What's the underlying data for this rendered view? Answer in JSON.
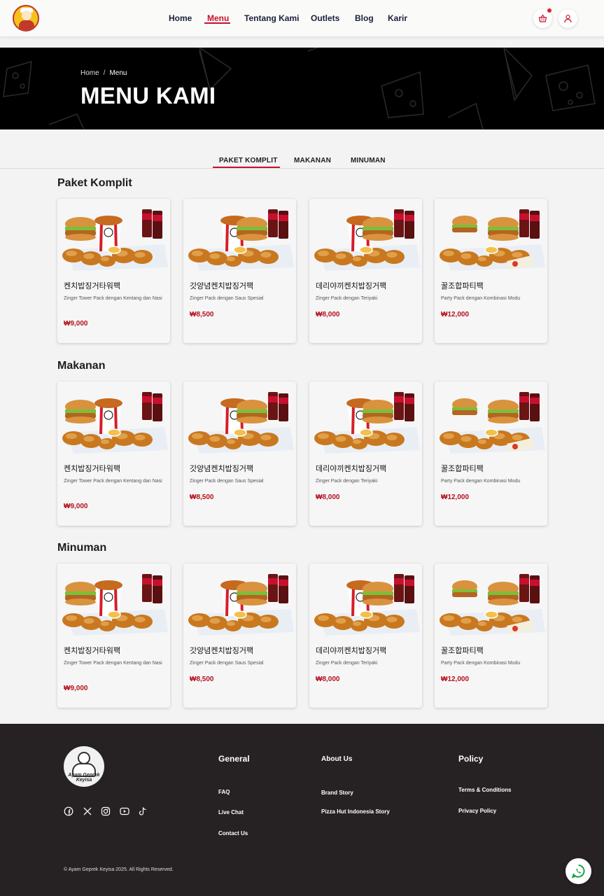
{
  "nav": {
    "items": [
      {
        "label": "Home",
        "active": false
      },
      {
        "label": "Menu",
        "active": true
      },
      {
        "label": "Tentang Kami",
        "active": false
      },
      {
        "label": "Outlets",
        "active": false
      },
      {
        "label": "Blog",
        "active": false
      },
      {
        "label": "Karir",
        "active": false
      }
    ],
    "icons": [
      "basket-icon",
      "user-icon"
    ]
  },
  "hero": {
    "breadcrumb": [
      "Home",
      "Menu"
    ],
    "separator": "/",
    "title": "MENU KAMI"
  },
  "tabs": [
    "PAKET KOMPLIT",
    "MAKANAN",
    "MINUMAN"
  ],
  "sections": [
    {
      "title": "Paket Komplit",
      "items": [
        {
          "name": "켄치밥징거타워팩",
          "desc": "Zinger Tower Pack dengan Kentang dan Nasi",
          "price": "₩9,000"
        },
        {
          "name": "갓양념켄치밥징거팩",
          "desc": "Zinger Pack dengan Saus Spesial",
          "price": "₩8,500"
        },
        {
          "name": "데리야끼켄치밥징거팩",
          "desc": "Zinger Pack dengan Teriyaki",
          "price": "₩8,000"
        },
        {
          "name": "꿀조합파티팩",
          "desc": "Party Pack dengan Kombinasi Modu",
          "price": "₩12,000"
        }
      ]
    },
    {
      "title": "Makanan",
      "items": [
        {
          "name": "켄치밥징거타워팩",
          "desc": "Zinger Tower Pack dengan Kentang dan Nasi",
          "price": "₩9,000"
        },
        {
          "name": "갓양념켄치밥징거팩",
          "desc": "Zinger Pack dengan Saus Spesial",
          "price": "₩8,500"
        },
        {
          "name": "데리야끼켄치밥징거팩",
          "desc": "Zinger Pack dengan Teriyaki",
          "price": "₩8,000"
        },
        {
          "name": "꿀조합파티팩",
          "desc": "Party Pack dengan Kombinasi Modu",
          "price": "₩12,000"
        }
      ]
    },
    {
      "title": "Minuman",
      "items": [
        {
          "name": "켄치밥징거타워팩",
          "desc": "Zinger Tower Pack dengan Kentang dan Nasi",
          "price": "₩9,000"
        },
        {
          "name": "갓양념켄치밥징거팩",
          "desc": "Zinger Pack dengan Saus Spesial",
          "price": "₩8,500"
        },
        {
          "name": "데리야끼켄치밥징거팩",
          "desc": "Zinger Pack dengan Teriyaki",
          "price": "₩8,000"
        },
        {
          "name": "꿀조합파티팩",
          "desc": "Party Pack dengan Kombinasi Modu",
          "price": "₩12,000"
        }
      ]
    }
  ],
  "footer": {
    "logo_text": "Ayam Geprek Keyisa",
    "social_icons": [
      "facebook-icon",
      "x-icon",
      "instagram-icon",
      "youtube-icon",
      "tiktok-icon"
    ],
    "columns": [
      {
        "heading": "General",
        "links": [
          "FAQ",
          "Live Chat",
          "Contact Us"
        ]
      },
      {
        "heading": "About Us",
        "links": [
          "Brand Story",
          "Pizza Hut Indonesia Story"
        ]
      },
      {
        "heading": "Policy",
        "links": [
          "Terms & Conditions",
          "Privacy Policy"
        ]
      }
    ],
    "copyright": "© Ayam Geprek Keyisa 2025. All Rights Reserved."
  },
  "colors": {
    "accent": "#c8102e",
    "price": "#b5121b",
    "nav_text": "#1b1f3a",
    "hero_bg": "#000000",
    "footer_bg": "#262223",
    "page_bg": "#f3f3f4"
  }
}
